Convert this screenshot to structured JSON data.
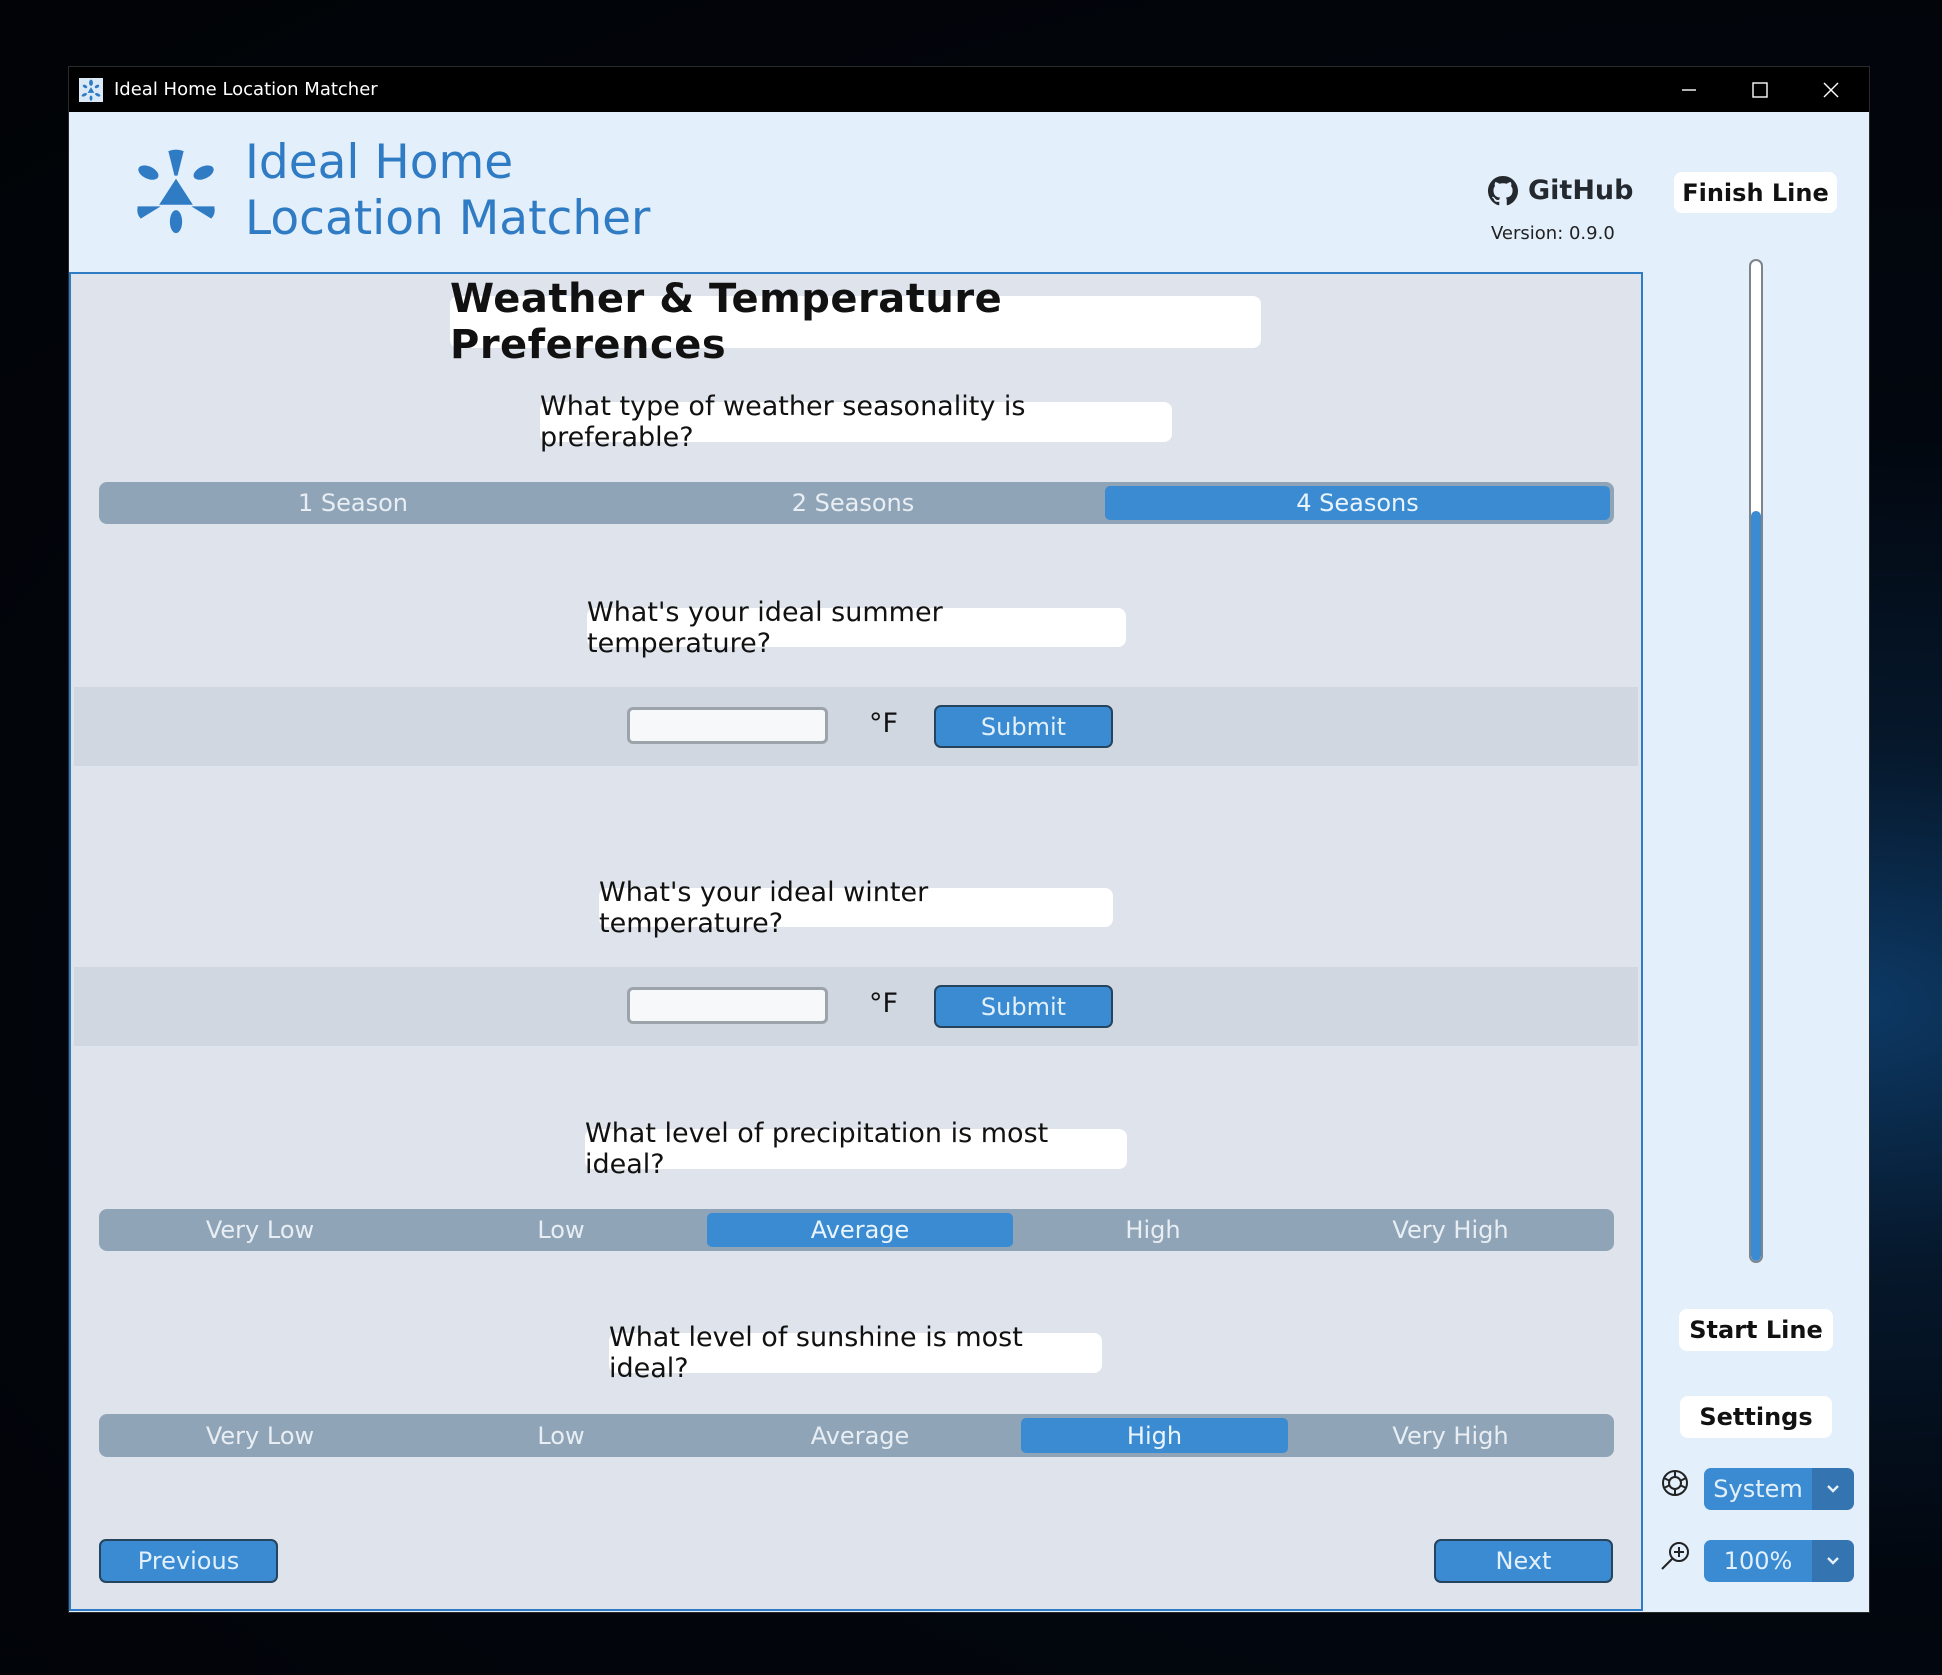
{
  "window": {
    "title": "Ideal Home Location Matcher",
    "controls": {
      "minimize": "—",
      "maximize": "☐",
      "close": "✕"
    }
  },
  "header": {
    "brand_line1": "Ideal Home",
    "brand_line2": "Location Matcher",
    "github_label": "GitHub",
    "version": "Version: 0.9.0"
  },
  "page": {
    "title": "Weather & Temperature Preferences",
    "questions": {
      "seasonality": {
        "label": "What type of weather seasonality is preferable?",
        "options": [
          "1 Season",
          "2 Seasons",
          "4 Seasons"
        ],
        "selected": "4 Seasons"
      },
      "summer_temp": {
        "label": "What's your ideal summer temperature?",
        "value": "",
        "placeholder": "",
        "unit": "°F",
        "submit_label": "Submit"
      },
      "winter_temp": {
        "label": "What's your ideal winter temperature?",
        "value": "",
        "placeholder": "",
        "unit": "°F",
        "submit_label": "Submit"
      },
      "precipitation": {
        "label": "What level of precipitation is most ideal?",
        "options": [
          "Very Low",
          "Low",
          "Average",
          "High",
          "Very High"
        ],
        "selected": "Average"
      },
      "sunshine": {
        "label": "What level of sunshine is most ideal?",
        "options": [
          "Very Low",
          "Low",
          "Average",
          "High",
          "Very High"
        ],
        "selected": "High"
      }
    },
    "nav": {
      "previous_label": "Previous",
      "next_label": "Next"
    }
  },
  "sidebar": {
    "finish_label": "Finish Line",
    "start_label": "Start Line",
    "progress_fraction": 0.75,
    "settings_label": "Settings",
    "theme": {
      "icon": "appearance-wheel-icon",
      "value": "System"
    },
    "zoom": {
      "icon": "zoom-in-icon",
      "value": "100%"
    }
  },
  "colors": {
    "accent": "#3a8bd2",
    "brand_text": "#2f7bc4",
    "segment_bg": "#8fa5b7",
    "content_bg": "#dfe3eb",
    "header_bg": "#e3effa"
  }
}
